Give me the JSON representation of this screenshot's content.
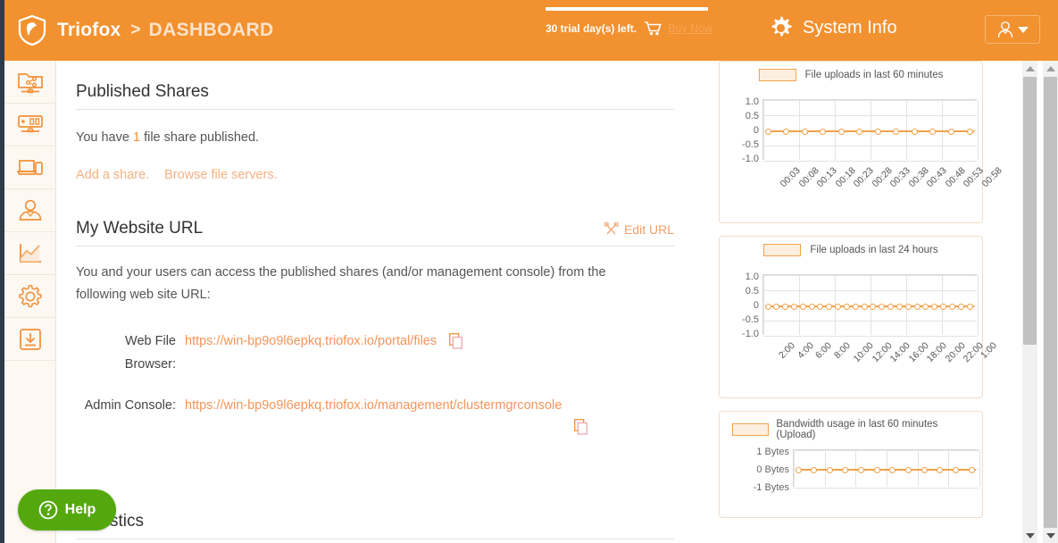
{
  "header": {
    "brand": "Triofox",
    "separator": ">",
    "page": "DASHBOARD",
    "trial_text": "30 trial day(s) left.",
    "buy_now": "Buy Now",
    "system_info": "System Info",
    "cart_icon": "cart-icon",
    "gear_icon": "gear-icon",
    "avatar_icon": "user-avatar-icon",
    "accent_color": "#f2912f"
  },
  "sidebar": {
    "items": [
      {
        "icon": "shared-folder-icon",
        "name": "sidebar-item-shared-folders"
      },
      {
        "icon": "monitor-dashboard-icon",
        "name": "sidebar-item-dashboard"
      },
      {
        "icon": "devices-icon",
        "name": "sidebar-item-devices"
      },
      {
        "icon": "user-icon",
        "name": "sidebar-item-users"
      },
      {
        "icon": "chart-icon",
        "name": "sidebar-item-reports"
      },
      {
        "icon": "gear-icon",
        "name": "sidebar-item-settings"
      },
      {
        "icon": "download-icon",
        "name": "sidebar-item-downloads"
      }
    ]
  },
  "published_shares": {
    "title": "Published Shares",
    "sentence_prefix": "You have ",
    "count": "1",
    "sentence_suffix": " file share published.",
    "add_share_link": "Add a share.",
    "browse_link": "Browse file servers."
  },
  "website_url": {
    "title": "My Website URL",
    "edit_label": "Edit URL",
    "edit_icon": "tools-icon",
    "description": "You and your users can access the published shares (and/or management console) from the following web site URL:",
    "rows": [
      {
        "label": "Web File Browser:",
        "url": "https://win-bp9o9l6epkq.triofox.io/portal/files",
        "copy_icon": "copy-icon"
      },
      {
        "label": "Admin Console:",
        "url": "https://win-bp9o9l6epkq.triofox.io/management/clustermgrconsole",
        "copy_icon": "copy-icon"
      }
    ]
  },
  "statistics": {
    "title": "Statistics"
  },
  "help": {
    "label": "Help",
    "icon": "question-circle-icon",
    "color": "#54a80d"
  },
  "chart_data": [
    {
      "type": "line",
      "title": "File uploads in last 60 minutes",
      "legend": [
        "File uploads in last 60 minutes"
      ],
      "legend_position": "top",
      "grid": true,
      "xlabel": "",
      "ylabel": "",
      "ylim": [
        -1.0,
        1.0
      ],
      "yticks": [
        "1.0",
        "0.5",
        "0",
        "-0.5",
        "-1.0"
      ],
      "categories": [
        "00:03",
        "00:08",
        "00:13",
        "00:18",
        "00:23",
        "00:28",
        "00:33",
        "00:38",
        "00:43",
        "00:48",
        "00:53",
        "00:58"
      ],
      "values": [
        0,
        0,
        0,
        0,
        0,
        0,
        0,
        0,
        0,
        0,
        0,
        0
      ]
    },
    {
      "type": "line",
      "title": "File uploads in last 24 hours",
      "legend": [
        "File uploads in last 24 hours"
      ],
      "legend_position": "top",
      "grid": true,
      "xlabel": "",
      "ylabel": "",
      "ylim": [
        -1.0,
        1.0
      ],
      "yticks": [
        "1.0",
        "0.5",
        "0",
        "-0.5",
        "-1.0"
      ],
      "categories": [
        "2:00",
        "4:00",
        "6:00",
        "8:00",
        "10:00",
        "12:00",
        "14:00",
        "16:00",
        "18:00",
        "20:00",
        "22:00",
        "1:00"
      ],
      "values": [
        0,
        0,
        0,
        0,
        0,
        0,
        0,
        0,
        0,
        0,
        0,
        0,
        0,
        0,
        0,
        0,
        0,
        0,
        0,
        0,
        0,
        0,
        0,
        0
      ]
    },
    {
      "type": "line",
      "title": "Bandwidth usage in last 60 minutes (Upload)",
      "legend": [
        "Bandwidth usage in last 60 minutes (Upload)"
      ],
      "legend_position": "top",
      "grid": true,
      "xlabel": "",
      "ylabel": "",
      "ylim": [
        -1,
        1
      ],
      "yticks": [
        "1 Bytes",
        "0 Bytes",
        "-1 Bytes"
      ],
      "categories": [
        "",
        "",
        "",
        "",
        "",
        "",
        "",
        "",
        "",
        "",
        "",
        ""
      ],
      "values": [
        0,
        0,
        0,
        0,
        0,
        0,
        0,
        0,
        0,
        0,
        0,
        0
      ]
    }
  ]
}
